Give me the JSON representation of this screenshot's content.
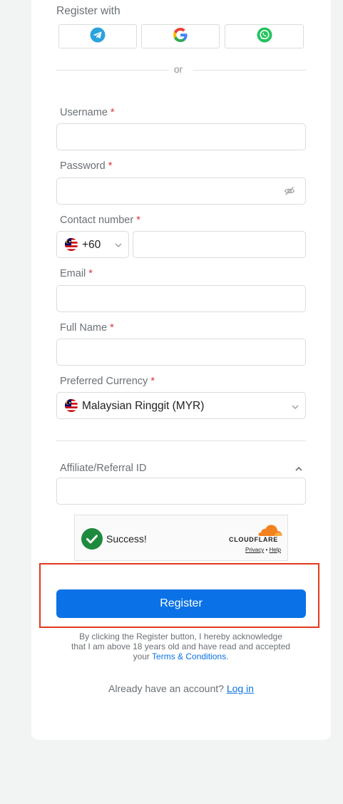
{
  "register_with": {
    "label": "Register with",
    "providers": [
      "telegram-icon",
      "google-icon",
      "whatsapp-icon"
    ]
  },
  "divider": {
    "text": "or"
  },
  "fields": {
    "username": {
      "label": "Username",
      "required_mark": "*",
      "value": ""
    },
    "password": {
      "label": "Password",
      "required_mark": "*",
      "value": ""
    },
    "contact": {
      "label": "Contact number",
      "required_mark": "*",
      "country_code": "+60",
      "value": ""
    },
    "email": {
      "label": "Email",
      "required_mark": "*",
      "value": ""
    },
    "full_name": {
      "label": "Full Name",
      "required_mark": "*",
      "value": ""
    },
    "currency": {
      "label": "Preferred Currency",
      "required_mark": "*",
      "selected": "Malaysian Ringgit (MYR)"
    },
    "affiliate": {
      "label": "Affiliate/Referral ID",
      "value": ""
    }
  },
  "captcha": {
    "status": "Success!",
    "brand": "CLOUDFLARE",
    "privacy": "Privacy",
    "separator": "•",
    "help": "Help"
  },
  "register_button": {
    "label": "Register"
  },
  "disclaimer": {
    "text": "By clicking the Register button, I hereby acknowledge that I am above 18 years old and have read and accepted your",
    "link": "Terms & Conditions",
    "end": "."
  },
  "footer": {
    "prompt": "Already have an account?",
    "login_link": "Log in"
  },
  "colors": {
    "accent": "#0a72e6",
    "required": "#e0313c",
    "success": "#1e8a3e",
    "highlight": "#e2391e"
  }
}
